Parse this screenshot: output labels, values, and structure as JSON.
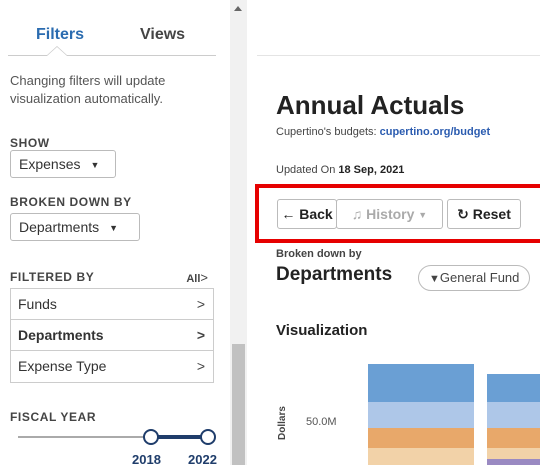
{
  "sidebar": {
    "tabs": [
      {
        "label": "Filters",
        "active": true
      },
      {
        "label": "Views",
        "active": false
      }
    ],
    "note": "Changing filters will update visualization automatically.",
    "show": {
      "label": "SHOW",
      "value": "Expenses"
    },
    "broken_down_by": {
      "label": "BROKEN DOWN BY",
      "value": "Departments"
    },
    "filtered_by": {
      "label": "FILTERED BY",
      "all_label": "All",
      "items": [
        {
          "label": "Funds",
          "active": false
        },
        {
          "label": "Departments",
          "active": true
        },
        {
          "label": "Expense Type",
          "active": false
        }
      ]
    },
    "fiscal_year": {
      "label": "FISCAL YEAR",
      "start": "2018",
      "end": "2022"
    }
  },
  "main": {
    "title": "Annual Actuals",
    "budget_prefix": "Cupertino's budgets: ",
    "budget_link": "cupertino.org/budget",
    "updated_prefix": "Updated On ",
    "updated_date": "18 Sep, 2021",
    "buttons": {
      "back": "← Back",
      "history": "History",
      "reset": "Reset"
    },
    "broken_down_label": "Broken down by",
    "broken_down_value": "Departments",
    "fund_filter": "General Fund",
    "viz_title": "Visualization",
    "y_axis_label": "Dollars",
    "tick_label": "50.0M"
  },
  "colors": {
    "accent": "#2b6cb0",
    "highlight": "#e60000",
    "bar_blue": "#6a9fd4",
    "bar_light_blue": "#aec7e8",
    "bar_orange": "#e8a86a",
    "bar_tan": "#f2d2a8",
    "bar_purple": "#9a8ac2"
  }
}
